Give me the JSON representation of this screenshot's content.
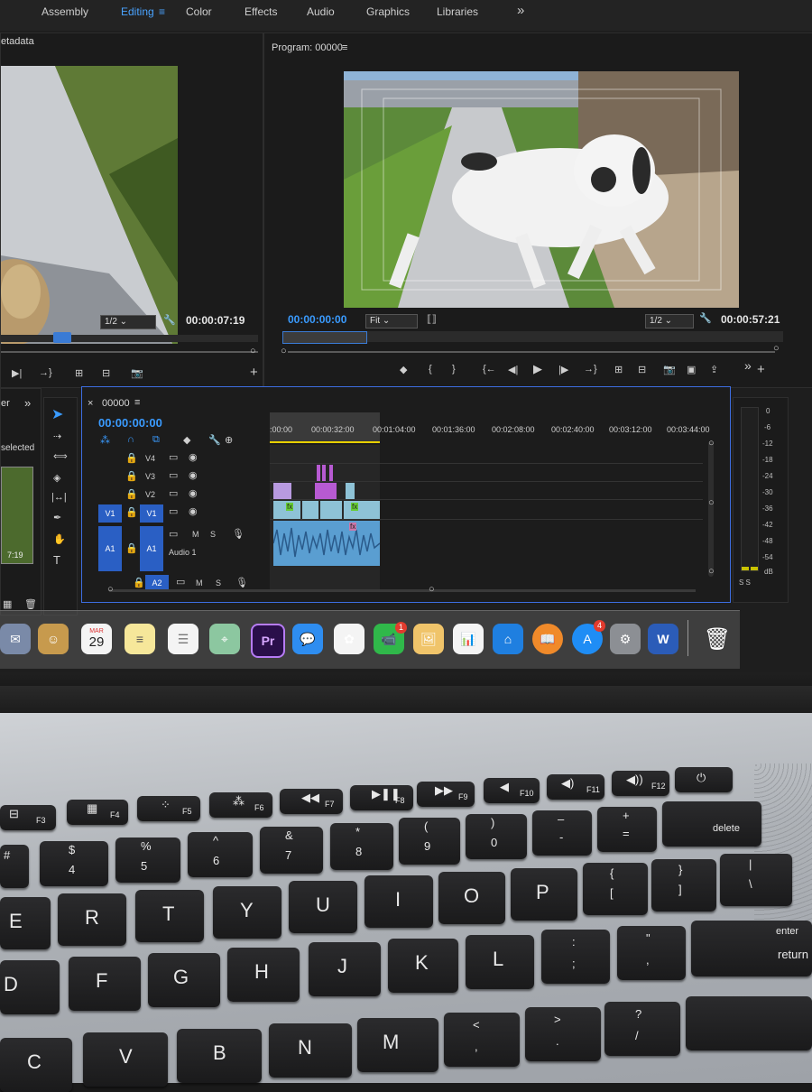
{
  "workspaces": [
    "Assembly",
    "Editing",
    "Color",
    "Effects",
    "Audio",
    "Graphics",
    "Libraries"
  ],
  "overflow_glyph": "»",
  "source_panel": {
    "title_fragment": "etadata",
    "resolution": "1/2",
    "timecode": "00:00:07:19"
  },
  "program_panel": {
    "title": "Program: 00000",
    "in_timecode": "00:00:00:00",
    "fit": "Fit",
    "resolution": "1/2",
    "timecode": "00:00:57:21"
  },
  "project_panel": {
    "title_fragment": "er",
    "selected_fragment": "selected",
    "thumb_time": "7:19"
  },
  "timeline": {
    "sequence": "00000",
    "timecode": "00:00:00:00",
    "ruler": [
      ":00:00",
      "00:00:32:00",
      "00:01:04:00",
      "00:01:36:00",
      "00:02:08:00",
      "00:02:40:00",
      "00:03:12:00",
      "00:03:44:00"
    ],
    "tracks": {
      "v4": "V4",
      "v3": "V3",
      "v2": "V2",
      "v1": "V1",
      "v1src": "V1",
      "a1": "A1",
      "a1src": "A1",
      "a2": "A2",
      "audio1": "Audio 1",
      "m": "M",
      "s": "S"
    },
    "fx": "fx"
  },
  "meter": {
    "labels": [
      "0",
      "-6",
      "-12",
      "-18",
      "-24",
      "-30",
      "-36",
      "-42",
      "-48",
      "-54",
      "dB"
    ],
    "solo": "S S"
  },
  "dock": {
    "calendar_month": "MAR",
    "calendar_day": "29",
    "premiere": "Pr",
    "facetime_badge": "1",
    "appstore_badge": "4",
    "word": "W"
  },
  "keys": {
    "f3": "F3",
    "f4": "F4",
    "f5": "F5",
    "f6": "F6",
    "f7": "F7",
    "f8": "F8",
    "f9": "F9",
    "f10": "F10",
    "f11": "F11",
    "f12": "F12",
    "hash": "#",
    "n4top": "$",
    "n4": "4",
    "n5top": "%",
    "n5": "5",
    "n6top": "^",
    "n6": "6",
    "n7top": "&",
    "n7": "7",
    "n8top": "*",
    "n8": "8",
    "n9top": "(",
    "n9": "9",
    "n0top": ")",
    "n0": "0",
    "minus_top": "–",
    "minus": "-",
    "plus": "+",
    "equals": "=",
    "delete": "delete",
    "E": "E",
    "R": "R",
    "T": "T",
    "Y": "Y",
    "U": "U",
    "I": "I",
    "O": "O",
    "P": "P",
    "lb_top": "{",
    "lb": "[",
    "rb_top": "}",
    "rb": "]",
    "bs_top": "|",
    "bs": "\\",
    "D": "D",
    "F": "F",
    "G": "G",
    "H": "H",
    "J": "J",
    "K": "K",
    "L": "L",
    "colon": ":",
    "semicolon": ";",
    "quote_top": "\"",
    "quote": ",",
    "enter": "enter",
    "return": "return",
    "C": "C",
    "V": "V",
    "B": "B",
    "N": "N",
    "M": "M",
    "lt": "<",
    "comma": ",",
    "gt": ">",
    "period": ".",
    "q": "?",
    "slash": "/"
  },
  "colors": {
    "accent": "#3a9bff",
    "timeline_border": "#3d6de0",
    "track_blue": "#2a5fc4"
  }
}
